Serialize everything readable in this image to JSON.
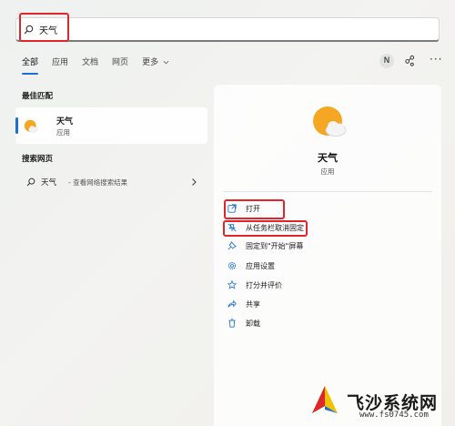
{
  "search": {
    "query": "天气"
  },
  "tabs": [
    {
      "label": "全部"
    },
    {
      "label": "应用"
    },
    {
      "label": "文档"
    },
    {
      "label": "网页"
    },
    {
      "label": "更多"
    }
  ],
  "user_initial": "N",
  "best_match": {
    "section_title": "最佳匹配",
    "name": "天气",
    "type": "应用"
  },
  "web_search": {
    "section_title": "搜索网页",
    "query": "天气",
    "hint": "- 查看网络搜索结果"
  },
  "detail": {
    "name": "天气",
    "type": "应用",
    "actions": [
      {
        "label": "打开",
        "icon": "open-external-icon"
      },
      {
        "label": "从任务栏取消固定",
        "icon": "unpin-icon"
      },
      {
        "label": "固定到\"开始\"屏幕",
        "icon": "pin-icon"
      },
      {
        "label": "应用设置",
        "icon": "gear-icon"
      },
      {
        "label": "打分并评价",
        "icon": "star-icon"
      },
      {
        "label": "共享",
        "icon": "share-icon"
      },
      {
        "label": "卸载",
        "icon": "trash-icon"
      }
    ]
  },
  "watermark": {
    "brand": "飞沙系统网",
    "url": "www.fs0745.com"
  },
  "colors": {
    "accent": "#1a6fd0",
    "highlight": "#e0262b",
    "weather_sun": "#f5a623"
  }
}
